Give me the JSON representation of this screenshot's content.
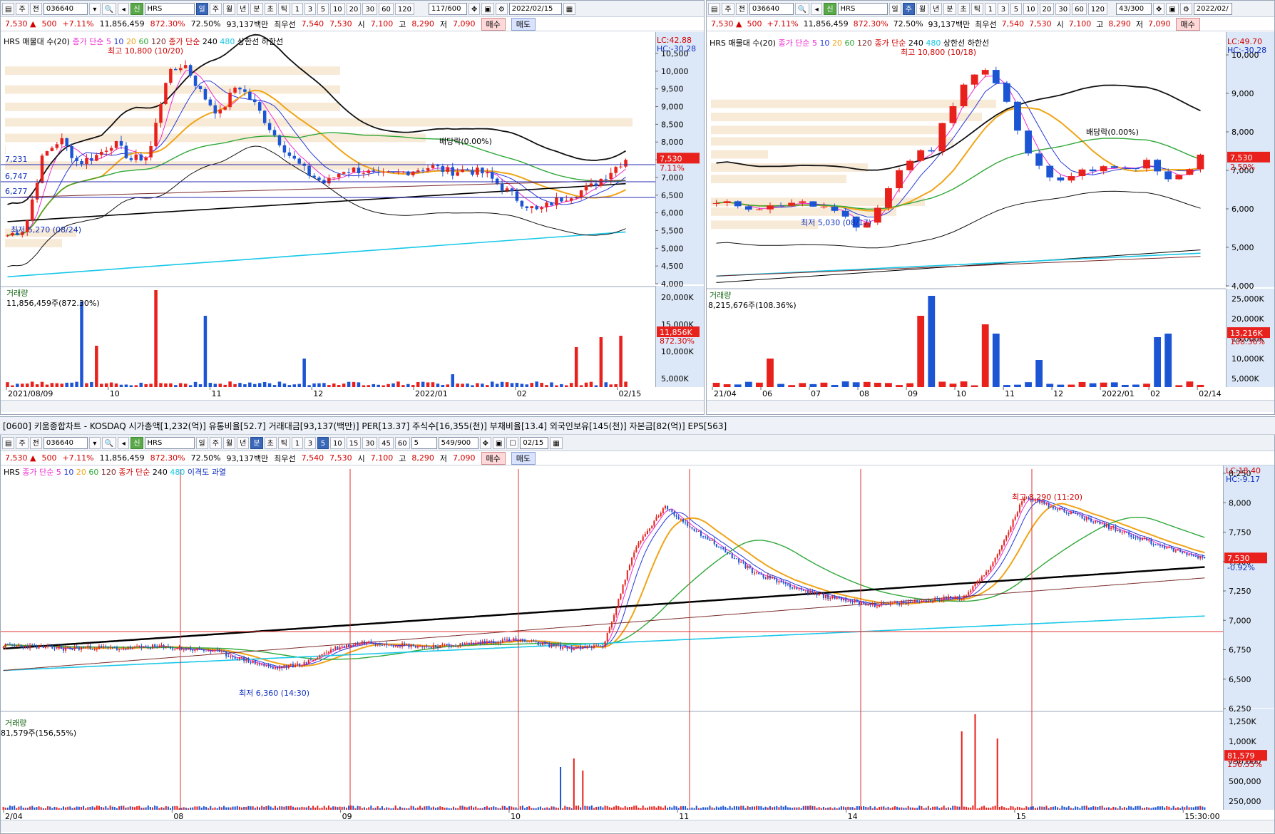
{
  "common": {
    "code": "036640",
    "name": "HRS",
    "chart_types": [
      "일",
      "주",
      "월",
      "년",
      "분",
      "초",
      "틱"
    ],
    "periods": [
      "1",
      "3",
      "5",
      "10",
      "20",
      "30",
      "60",
      "120"
    ],
    "min_periods": [
      "1",
      "3",
      "5",
      "10",
      "15",
      "30",
      "45",
      "60"
    ],
    "market_flag": "신",
    "btn_buy": "매수",
    "btn_sell": "매도"
  },
  "quote": {
    "price": "7,530",
    "arrow": "▲",
    "change": "500",
    "change_pct": "+7.11%",
    "volume": "11,856,459",
    "vol_pct": "872.30%",
    "rate": "72.50%",
    "amount": "93,137백만",
    "best_ask_lbl": "최우선",
    "best_ask": "7,540",
    "best_bid": "7,530",
    "open_lbl": "시",
    "open": "7,100",
    "high_lbl": "고",
    "high": "8,290",
    "low_lbl": "저",
    "low": "7,090"
  },
  "top_left": {
    "type_sel": "주",
    "mode": "전",
    "count": "117/600",
    "date": "2022/02/15",
    "legend": {
      "indicator": "HRS 매물대 수(20)",
      "ma_label": "종가 단순",
      "ma": [
        "5",
        "10",
        "20",
        "60",
        "120"
      ],
      "ma2_label": "종가 단순",
      "ma2": [
        "240",
        "480"
      ],
      "bands": "상한선",
      "bands2": "하한선"
    },
    "lc": "LC:42.88",
    "hc": "HC:-30.28",
    "high_note": "최고 10,800 (10/20)",
    "low_note": "최저 5,270 (08/24)",
    "div_note": "배당락(0.00%)",
    "levels": [
      "7,231",
      "6,747",
      "6,277"
    ],
    "y_labels": [
      "10,500",
      "10,000",
      "9,500",
      "9,000",
      "8,500",
      "8,000",
      "7,500",
      "7,000",
      "6,500",
      "6,000",
      "5,500",
      "5,000",
      "4,500",
      "4,000"
    ],
    "price_tag": "7,530",
    "pct_tag": "7.11%",
    "vol_title": "거래량",
    "vol_text": "11,856,459주(872.30%)",
    "vol_y": [
      "20,000K",
      "15,000K",
      "10,000K",
      "5,000K"
    ],
    "vol_tag": "11,856K",
    "vol_tag2": "872.30%",
    "x_labels": [
      "2021/08/09",
      "10",
      "11",
      "12",
      "2022/01",
      "02",
      "02/15"
    ]
  },
  "top_right": {
    "type_sel": "주",
    "count": "43/300",
    "date": "2022/02/",
    "legend": {
      "indicator": "HRS 매물대 수(20)",
      "ma_label": "종가 단순",
      "ma": [
        "5",
        "10",
        "20",
        "60",
        "120"
      ],
      "ma2_label": "종가 단순",
      "ma2": [
        "240",
        "480"
      ],
      "bands": "상한선",
      "bands2": "하한선"
    },
    "lc": "LC:49.70",
    "hc": "HC:-30.28",
    "high_note": "최고 10,800 (10/18)",
    "low_note": "최저 5,030 (08/17)",
    "div_note": "배당락(0.00%)",
    "y_labels": [
      "10,000",
      "9,000",
      "8,000",
      "7,000",
      "6,000",
      "5,000",
      "4,000"
    ],
    "price_tag": "7,530",
    "pct_tag": "2.59%",
    "vol_title": "거래량",
    "vol_text": "8,215,676주(108.36%)",
    "vol_y": [
      "25,000K",
      "20,000K",
      "15,000K",
      "10,000K",
      "5,000K"
    ],
    "vol_tag": "13,216K",
    "vol_tag2": "108.36%",
    "x_labels": [
      "21/04",
      "06",
      "07",
      "08",
      "09",
      "10",
      "11",
      "12",
      "2022/01",
      "02",
      "02/14"
    ]
  },
  "bottom": {
    "window_title": "[0600] 키움종합차트 - KOSDAQ 시가총액[1,232(억)] 유통비율[52.7] 거래대금[93,137(백만)] PER[13.37] 주식수[16,355(천)] 부채비율[13.4] 외국인보유[145(천)] 자본금[82(억)] EPS[563]",
    "type_sel": "주",
    "mode": "전",
    "min_sel": "5",
    "count": "549/900",
    "date": "02/15",
    "legend": {
      "name": "HRS",
      "ma_label": "종가 단순",
      "ma": [
        "5",
        "10",
        "20",
        "60",
        "120"
      ],
      "ma2_label": "종가 단순",
      "ma2": [
        "240",
        "480"
      ],
      "extra": "이격도 과열"
    },
    "lc": "LC:18.40",
    "hc": "HC:-9.17",
    "high_note": "최고 8,290 (11:20)",
    "low_note": "최저 6,360 (14:30)",
    "y_labels": [
      "8,250",
      "8,000",
      "7,750",
      "7,500",
      "7,250",
      "7,000",
      "6,750",
      "6,500",
      "6,250"
    ],
    "price_tag": "7,530",
    "pct_tag": "-0.92%",
    "vol_title": "거래량",
    "vol_text": "81,579주(156,55%)",
    "vol_y": [
      "1,250K",
      "1,000K",
      "750,000",
      "500,000",
      "250,000"
    ],
    "vol_tag": "81,579",
    "vol_tag2": "156.55%",
    "x_labels": [
      "2/04",
      "08",
      "09",
      "10",
      "11",
      "14",
      "15",
      "15:30:00"
    ]
  },
  "colors": {
    "up": "#e8211c",
    "down": "#1c55d4",
    "ma5": "#ee2ad2",
    "ma10": "#2438d8",
    "ma20": "#f0a418",
    "ma60": "#2fa838",
    "ma120": "#7a2a2a",
    "ma240": "#000000",
    "ma480": "#18c8e8",
    "band": "#111111",
    "profile": "#f7ead7",
    "axis": "#dce8f7"
  }
}
